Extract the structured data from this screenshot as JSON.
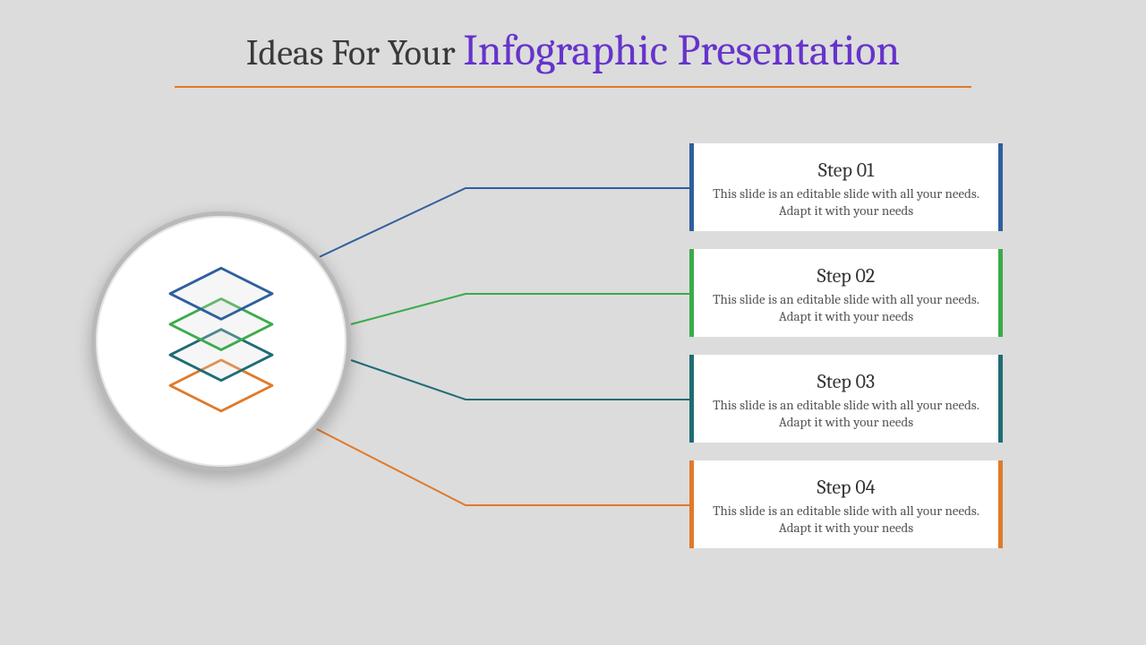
{
  "title": {
    "prefix": "Ideas For Your ",
    "main": "Infographic Presentation"
  },
  "colors": {
    "step1": "#2f5f9e",
    "step2": "#3bab4a",
    "step3": "#1e6d74",
    "step4": "#e07a2a"
  },
  "steps": [
    {
      "title": "Step 01",
      "desc": "This slide is an editable slide with all your needs. Adapt it with your needs"
    },
    {
      "title": "Step 02",
      "desc": "This slide is an editable slide with all your needs. Adapt it with your needs"
    },
    {
      "title": "Step 03",
      "desc": "This slide is an editable slide with all your needs. Adapt it with your needs"
    },
    {
      "title": "Step 04",
      "desc": "This slide is an editable slide with all your needs. Adapt it with your needs"
    }
  ]
}
